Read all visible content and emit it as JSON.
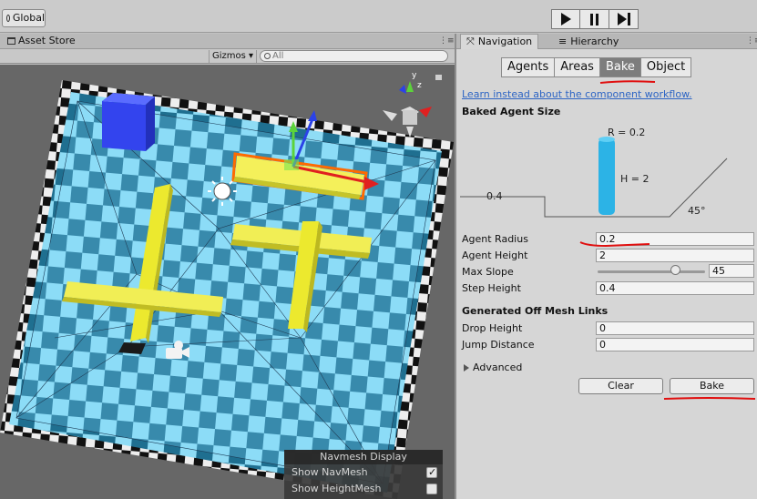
{
  "toolbar": {
    "global_label": "Global",
    "play_icon": "play-icon",
    "pause_icon": "pause-icon",
    "step_icon": "step-icon"
  },
  "scene": {
    "asset_store_tab": "Asset Store",
    "gizmos_label": "Gizmos",
    "search_placeholder": "All",
    "navmesh_display": {
      "title": "Navmesh Display",
      "show_navmesh": "Show NavMesh",
      "show_navmesh_checked": true,
      "show_heightmesh": "Show HeightMesh",
      "show_heightmesh_checked": false
    },
    "gizmo_y": "y",
    "gizmo_z": "z"
  },
  "navigation": {
    "tab_navigation": "Navigation",
    "tab_hierarchy": "Hierarchy",
    "segments": [
      "Agents",
      "Areas",
      "Bake",
      "Object"
    ],
    "active_segment": "Bake",
    "link_text": "Learn instead about the component workflow.",
    "baked_agent_size_title": "Baked Agent Size",
    "diagram": {
      "r_label": "R = 0.2",
      "h_label": "H = 2",
      "step_label": "0.4",
      "slope_label": "45°"
    },
    "fields": {
      "agent_radius_label": "Agent Radius",
      "agent_radius_value": "0.2",
      "agent_height_label": "Agent Height",
      "agent_height_value": "2",
      "max_slope_label": "Max Slope",
      "max_slope_value": "45",
      "step_height_label": "Step Height",
      "step_height_value": "0.4"
    },
    "offmesh_title": "Generated Off Mesh Links",
    "drop_height_label": "Drop Height",
    "drop_height_value": "0",
    "jump_distance_label": "Jump Distance",
    "jump_distance_value": "0",
    "advanced_label": "Advanced",
    "clear_button": "Clear",
    "bake_button": "Bake"
  },
  "colors": {
    "annotation_red": "#e01010",
    "navmesh_blue": "#7fd3ee",
    "agent_cyan": "#2cb3e6"
  }
}
